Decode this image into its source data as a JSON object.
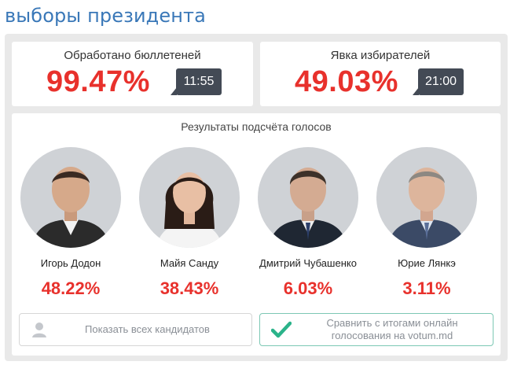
{
  "page_title": "выборы президента",
  "stats": [
    {
      "label": "Обработано бюллетеней",
      "value": "99.47%",
      "time": "11:55"
    },
    {
      "label": "Явка избирателей",
      "value": "49.03%",
      "time": "21:00"
    }
  ],
  "results": {
    "title": "Результаты подсчёта голосов",
    "candidates": [
      {
        "name": "Игорь Додон",
        "percent": "48.22%"
      },
      {
        "name": "Майя Санду",
        "percent": "38.43%"
      },
      {
        "name": "Дмитрий Чубашенко",
        "percent": "6.03%"
      },
      {
        "name": "Юрие Лянкэ",
        "percent": "3.11%"
      }
    ]
  },
  "buttons": {
    "show_all": {
      "label": "Показать всех кандидатов",
      "icon": "user-icon"
    },
    "compare": {
      "label": "Сравнить с итогами онлайн голосования на votum.md",
      "icon": "checkmark-icon"
    }
  },
  "colors": {
    "title_blue": "#3a78b8",
    "accent_red": "#e8312c",
    "badge_dark": "#434a55",
    "check_teal": "#2bb38a"
  }
}
